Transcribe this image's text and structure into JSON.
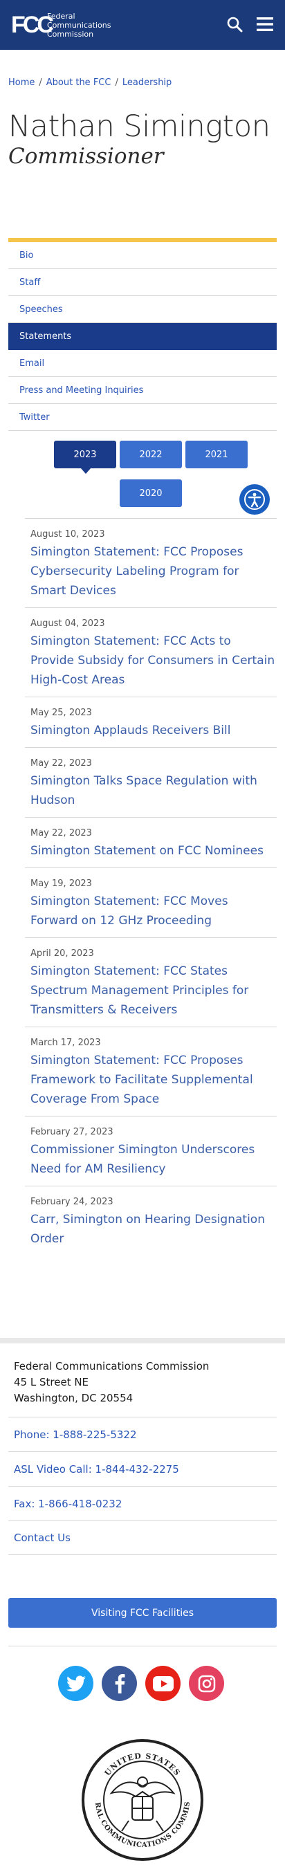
{
  "header": {
    "logo_mark": "FCC",
    "logo_lines": [
      "Federal",
      "Communications",
      "Commission"
    ],
    "search_icon": "search-icon",
    "menu_icon": "hamburger-menu-icon",
    "bg_color": "#1a3a7a"
  },
  "breadcrumb": [
    "Home",
    "About the FCC",
    "Leadership"
  ],
  "page": {
    "title": "Nathan Simington",
    "subtitle": "Commissioner"
  },
  "nav": {
    "items": [
      {
        "label": "Bio",
        "active": false
      },
      {
        "label": "Staff",
        "active": false
      },
      {
        "label": "Speeches",
        "active": false
      },
      {
        "label": "Statements",
        "active": true
      },
      {
        "label": "Email",
        "active": false
      },
      {
        "label": "Press and Meeting Inquiries",
        "active": false
      },
      {
        "label": "Twitter",
        "active": false
      }
    ]
  },
  "years": {
    "items": [
      "2023",
      "2022",
      "2021",
      "2020"
    ],
    "selected": "2023"
  },
  "statements": [
    {
      "date": "August 10, 2023",
      "title": "Simington Statement: FCC Proposes Cybersecurity Labeling Program for Smart Devices"
    },
    {
      "date": "August 04, 2023",
      "title": "Simington Statement: FCC Acts to Provide Subsidy for Consumers in Certain High-Cost Areas"
    },
    {
      "date": "May 25, 2023",
      "title": "Simington Applauds Receivers Bill"
    },
    {
      "date": "May 22, 2023",
      "title": "Simington Talks Space Regulation with Hudson"
    },
    {
      "date": "May 22, 2023",
      "title": "Simington Statement on FCC Nominees"
    },
    {
      "date": "May 19, 2023",
      "title": "Simington Statement: FCC Moves Forward on 12 GHz Proceeding"
    },
    {
      "date": "April 20, 2023",
      "title": "Simington Statement: FCC States Spectrum Management Principles for Transmitters & Receivers"
    },
    {
      "date": "March 17, 2023",
      "title": "Simington Statement: FCC Proposes Framework to Facilitate Supplemental Coverage From Space"
    },
    {
      "date": "February 27, 2023",
      "title": "Commissioner Simington Underscores Need for AM Resiliency"
    },
    {
      "date": "February 24, 2023",
      "title": "Carr, Simington on Hearing Designation Order"
    }
  ],
  "footer": {
    "address_lines": [
      "Federal Communications Commission",
      "45 L Street NE",
      "Washington, DC 20554"
    ],
    "phone": "Phone: 1-888-225-5322",
    "asl": "ASL Video Call: 1-844-432-2275",
    "fax": "Fax: 1-866-418-0232",
    "contact": "Contact Us",
    "visit_button": "Visiting FCC Facilities",
    "socials": [
      {
        "name": "twitter",
        "color": "#1da1f2"
      },
      {
        "name": "facebook",
        "color": "#3b5998"
      },
      {
        "name": "youtube",
        "color": "#e62117"
      },
      {
        "name": "instagram",
        "color": "#e4405f"
      }
    ],
    "seal_text_top": "UNITED STATES",
    "seal_text_bottom": "FEDERAL COMMUNICATIONS COMMISSION"
  },
  "accessibility_icon": "accessibility-icon"
}
